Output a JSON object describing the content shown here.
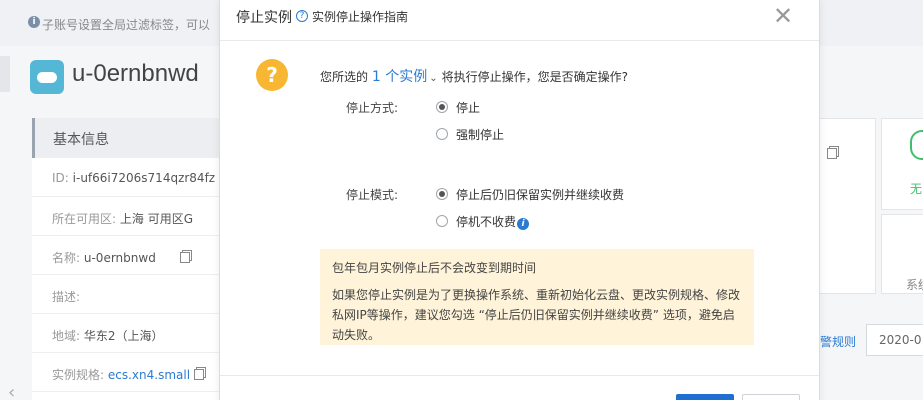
{
  "background": {
    "notice_text": "子账号设置全局过滤标签，可以",
    "instance_name": "u-0ernbnwd",
    "basic_info_title": "基本信息",
    "rows": [
      {
        "label": "ID:",
        "value": "i-uf66i7206s714qzr84fz"
      },
      {
        "label": "所在可用区:",
        "value": "上海 可用区G"
      },
      {
        "label": "名称:",
        "value": "u-0ernbnwd"
      },
      {
        "label": "描述:",
        "value": ""
      },
      {
        "label": "地域:",
        "value": "华东2（上海）"
      },
      {
        "label": "实例规格:",
        "value": "ecs.xn4.small"
      }
    ],
    "right_status_green": "无",
    "right_gray_text": "系统",
    "alarm_rule_link": "警规则",
    "date_value": "2020-0"
  },
  "modal": {
    "title": "停止实例",
    "guide_link": "实例停止操作指南",
    "question_prefix": "您所选的",
    "instance_count": "1 个实例",
    "question_suffix": "将执行停止操作，您是否确定操作?",
    "stop_method_label": "停止方式:",
    "stop_method_options": [
      "停止",
      "强制停止"
    ],
    "stop_method_selected": "停止",
    "stop_mode_label": "停止模式:",
    "stop_mode_options": [
      "停止后仍旧保留实例并继续收费",
      "停机不收费"
    ],
    "stop_mode_selected": "停止后仍旧保留实例并继续收费",
    "tip_title": "包年包月实例停止后不会改变到期时间",
    "tip_body": "如果您停止实例是为了更换操作系统、重新初始化云盘、更改实例规格、修改私网IP等操作，建议您勾选 “停止后仍旧保留实例并继续收费” 选项，避免启动失败。"
  },
  "colors": {
    "primary": "#2b7bd3",
    "warning": "#f7b733",
    "tip_bg": "#fff4d9"
  }
}
